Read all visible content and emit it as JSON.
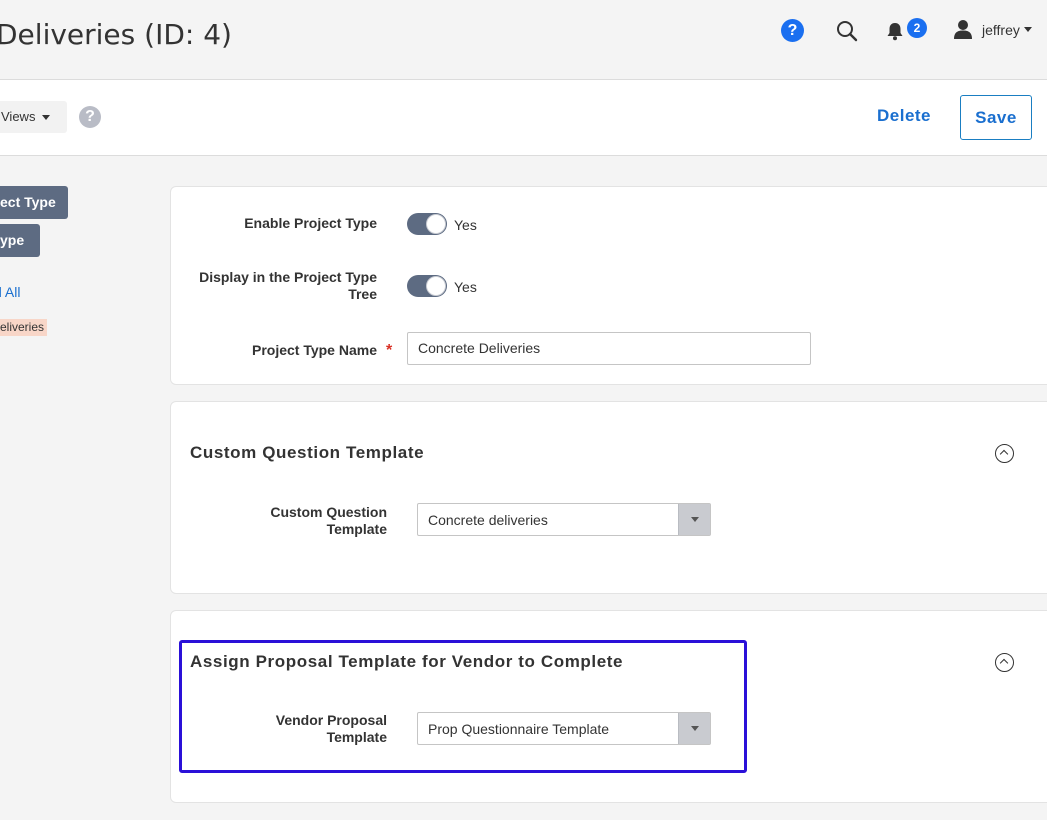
{
  "header": {
    "title": "Deliveries (ID: 4)",
    "help_label": "?",
    "notification_count": "2",
    "user_name": "jeffrey"
  },
  "toolbar": {
    "views_label": "Views",
    "help_label": "?",
    "delete_label": "Delete",
    "save_label": "Save"
  },
  "sidebar": {
    "buttons": [
      "ect Type",
      "ype"
    ],
    "link": "d All",
    "tag": "eliveries"
  },
  "general": {
    "enable_label": "Enable Project Type",
    "enable_value": "Yes",
    "display_label_line1": "Display in the Project Type",
    "display_label_line2": "Tree",
    "display_value": "Yes",
    "name_label": "Project Type Name",
    "required_mark": "*",
    "name_value": "Concrete Deliveries"
  },
  "custom_question": {
    "title": "Custom Question Template",
    "field_label_line1": "Custom Question",
    "field_label_line2": "Template",
    "selected": "Concrete deliveries"
  },
  "proposal": {
    "title": "Assign Proposal Template for Vendor to Complete",
    "field_label_line1": "Vendor Proposal",
    "field_label_line2": "Template",
    "selected": "Prop Questionnaire Template"
  },
  "colors": {
    "accent": "#1a6ff0",
    "link": "#1a6fcf",
    "toggle_on": "#5d6b82",
    "highlight": "#2a10d8"
  },
  "icons": [
    "help-icon",
    "search-icon",
    "bell-icon",
    "user-icon",
    "question-icon",
    "collapse-icon",
    "dropdown-arrow-icon"
  ]
}
